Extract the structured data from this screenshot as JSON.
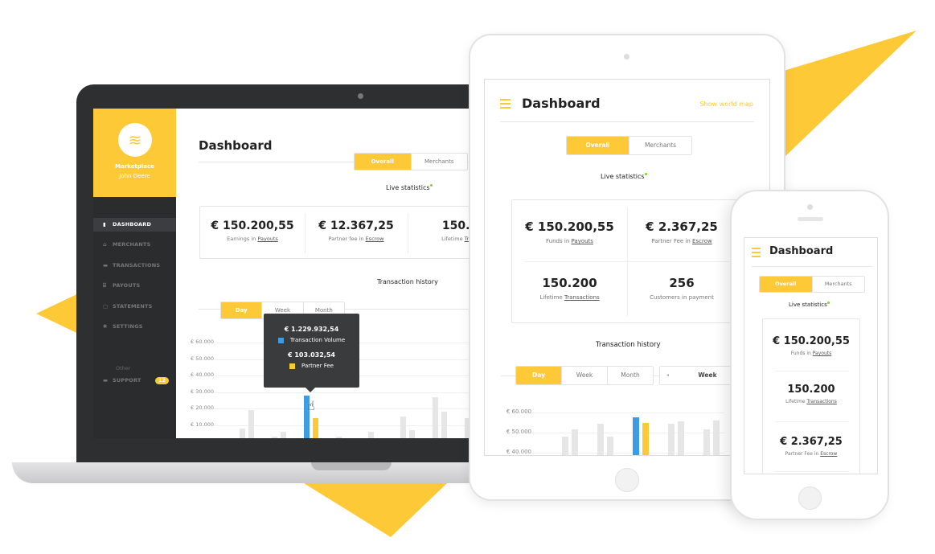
{
  "colors": {
    "accent": "#fec937",
    "sidebar": "#2b2c2e",
    "blue": "#3d9de4",
    "bar_gray": "#e6e6e6",
    "live": "#7ed321"
  },
  "laptop": {
    "brand": {
      "icon": "layers-icon",
      "name": "Marketplace",
      "user": "John Deere"
    },
    "nav": [
      {
        "label": "DASHBOARD",
        "icon": "bar-chart-icon",
        "glyph": "▮",
        "active": true
      },
      {
        "label": "MERCHANTS",
        "icon": "store-icon",
        "glyph": "⌂"
      },
      {
        "label": "TRANSACTIONS",
        "icon": "credit-card-icon",
        "glyph": "▬"
      },
      {
        "label": "PAYOUTS",
        "icon": "bank-icon",
        "glyph": "⌸"
      },
      {
        "label": "STATEMENTS",
        "icon": "document-icon",
        "glyph": "▢"
      },
      {
        "label": "SETTINGS",
        "icon": "gear-icon",
        "glyph": "✱"
      }
    ],
    "other_label": "Other",
    "support": {
      "label": "SUPPORT",
      "icon": "chat-icon",
      "glyph": "▬",
      "badge": "12"
    },
    "title": "Dashboard",
    "tabs": [
      "Overall",
      "Merchants"
    ],
    "live_label": "Live statistics",
    "stats": [
      {
        "value": "€ 150.200,55",
        "label": "Earnings in ",
        "link": "Payouts"
      },
      {
        "value": "€ 12.367,25",
        "label": "Partner fee in ",
        "link": "Escrow"
      },
      {
        "value": "150.2",
        "label": "Lifetime ",
        "link": "Trans"
      }
    ],
    "history_label": "Transaction history",
    "periods": [
      "Day",
      "Week",
      "Month"
    ],
    "tooltip": {
      "volume": "€ 1.229.932,54",
      "volume_label": "Transaction Volume",
      "fee": "€ 103.032,54",
      "fee_label": "Partner Fee"
    }
  },
  "tablet": {
    "title": "Dashboard",
    "world_map_link": "Show world map",
    "tabs": [
      "Overall",
      "Merchants"
    ],
    "live_label": "Live statistics",
    "stats": [
      {
        "value": "€ 150.200,55",
        "label": "Funds in ",
        "link": "Payouts"
      },
      {
        "value": "€ 2.367,25",
        "label": "Partner Fee in ",
        "link": "Escrow"
      },
      {
        "value": "150.200",
        "label": "Lifetime ",
        "link": "Transactions"
      },
      {
        "value": "256",
        "label": "Customers in payment",
        "link": ""
      }
    ],
    "history_label": "Transaction history",
    "periods": [
      "Day",
      "Week",
      "Month"
    ],
    "range_select": "Week"
  },
  "phone": {
    "title": "Dashboard",
    "tabs": [
      "Overall",
      "Merchants"
    ],
    "live_label": "Live statistics",
    "stats": [
      {
        "value": "€ 150.200,55",
        "label": "Funds in ",
        "link": "Payouts"
      },
      {
        "value": "150.200",
        "label": "Lifetime ",
        "link": "Transactions"
      },
      {
        "value": "€ 2.367,25",
        "label": "Partner Fee in ",
        "link": "Escrow"
      }
    ]
  },
  "chart_data": [
    {
      "type": "bar",
      "title": "Transaction history",
      "device": "laptop",
      "y_ticks": [
        "€ 10.000",
        "€ 20.000",
        "€ 30.000",
        "€ 40.000",
        "€ 50.000",
        "€ 60.000"
      ],
      "ylim": [
        0,
        60000
      ],
      "series": [
        {
          "name": "Transaction Volume",
          "values": [
            8000,
            3000,
            28000,
            3000,
            6000,
            15000,
            27000,
            14000
          ],
          "highlight_index": 2
        },
        {
          "name": "Partner Fee",
          "values": [
            19000,
            6000,
            14000,
            1000,
            2000,
            7000,
            18000,
            null
          ]
        }
      ]
    },
    {
      "type": "bar",
      "device": "tablet",
      "y_ticks": [
        "€ 40.000",
        "€ 50.000",
        "€ 60.000"
      ],
      "ylim": [
        36000,
        60000
      ],
      "series": [
        {
          "values": [
            48000,
            54500,
            57500,
            54500,
            51500
          ],
          "highlight_index": 2
        },
        {
          "values": [
            51500,
            48000,
            55000,
            55500,
            56000
          ]
        }
      ]
    }
  ]
}
